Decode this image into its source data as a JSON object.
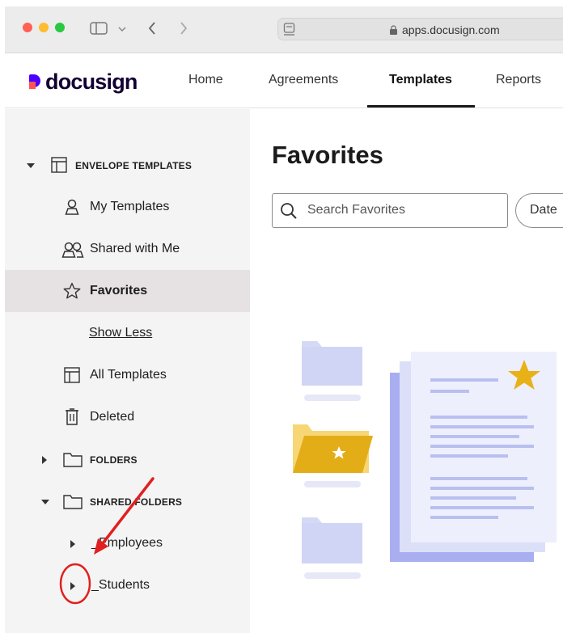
{
  "browser": {
    "address": "apps.docusign.com",
    "icons": [
      "sidebar-toggle-icon",
      "chevron-down-icon",
      "back-icon",
      "forward-icon",
      "reader-icon",
      "lock-icon"
    ]
  },
  "header": {
    "logo_text": "docusign",
    "nav": [
      "Home",
      "Agreements",
      "Templates",
      "Reports"
    ],
    "active_nav": "Templates"
  },
  "sidebar": {
    "envelope_templates": "ENVELOPE TEMPLATES",
    "items": [
      {
        "label": "My Templates",
        "icon": "person-icon"
      },
      {
        "label": "Shared with Me",
        "icon": "people-icon"
      },
      {
        "label": "Favorites",
        "icon": "star-icon"
      }
    ],
    "show_less": "Show Less",
    "all_templates": "All Templates",
    "deleted": "Deleted",
    "folders": "FOLDERS",
    "shared_folders": "SHARED FOLDERS",
    "shared_items": [
      "_Employees",
      "_Students"
    ]
  },
  "main": {
    "title": "Favorites",
    "search_placeholder": "Search Favorites",
    "date_label": "Date"
  },
  "colors": {
    "accent_purple": "#4c00ff",
    "logo_red": "#ff5252",
    "star_gold": "#e8b117",
    "annotation_red": "#e02020"
  }
}
